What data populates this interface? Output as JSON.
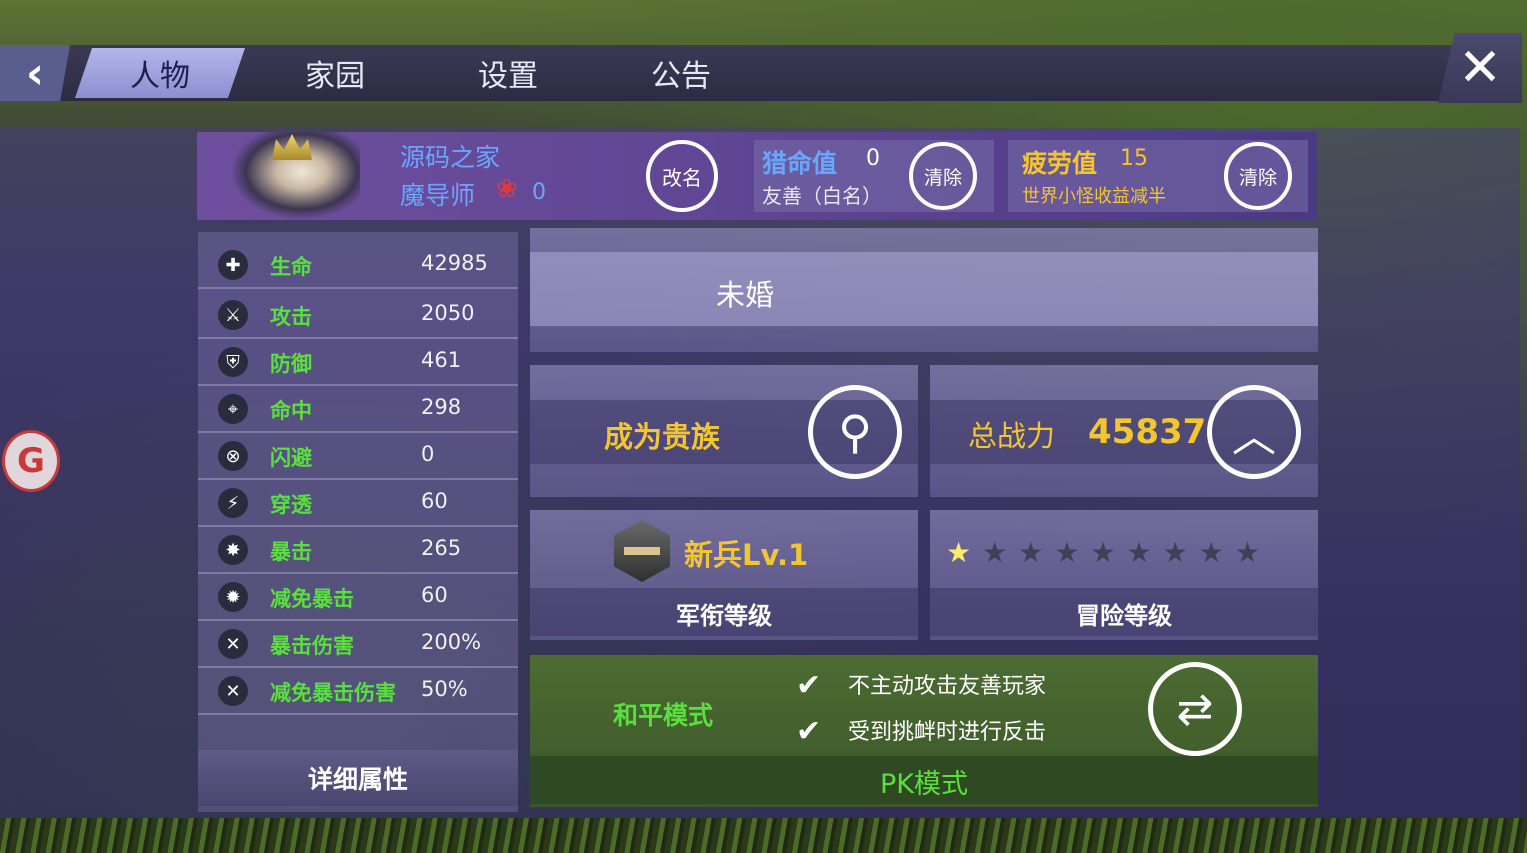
{
  "nav": {
    "tabs": [
      "人物",
      "家园",
      "设置",
      "公告"
    ],
    "active_tab": 0,
    "back_icon": "chevron-left-icon",
    "close_icon": "close-icon"
  },
  "profile": {
    "name": "源码之家",
    "class": "魔导师",
    "rose_count": "0",
    "rename_label": "改名"
  },
  "hunt": {
    "label": "猎命值",
    "value": "0",
    "status": "友善（白名）",
    "clear_label": "清除"
  },
  "fatigue": {
    "label": "疲劳值",
    "value": "15",
    "note": "世界小怪收益减半",
    "clear_label": "清除"
  },
  "stats": [
    {
      "icon": "plus-icon",
      "glyph": "✚",
      "name": "生命",
      "value": "42985"
    },
    {
      "icon": "sword-icon",
      "glyph": "⚔",
      "name": "攻击",
      "value": "2050"
    },
    {
      "icon": "shield-icon",
      "glyph": "⛨",
      "name": "防御",
      "value": "461"
    },
    {
      "icon": "crosshair-icon",
      "glyph": "⌖",
      "name": "命中",
      "value": "298"
    },
    {
      "icon": "dodge-icon",
      "glyph": "⊗",
      "name": "闪避",
      "value": "0"
    },
    {
      "icon": "pierce-icon",
      "glyph": "⚡",
      "name": "穿透",
      "value": "60"
    },
    {
      "icon": "crit-icon",
      "glyph": "✸",
      "name": "暴击",
      "value": "265"
    },
    {
      "icon": "crit-resist-icon",
      "glyph": "✹",
      "name": "减免暴击",
      "value": "60"
    },
    {
      "icon": "crit-damage-icon",
      "glyph": "✕",
      "name": "暴击伤害",
      "value": "200%"
    },
    {
      "icon": "crit-damage-resist-icon",
      "glyph": "✕",
      "name": "减免暴击伤害",
      "value": "50%"
    }
  ],
  "detail_label": "详细属性",
  "marriage_status": "未婚",
  "noble": {
    "label": "成为贵族"
  },
  "power": {
    "label": "总战力",
    "value": "45837"
  },
  "military": {
    "rank": "新兵Lv.1",
    "label": "军衔等级"
  },
  "adventure": {
    "stars_total": 9,
    "stars_filled": 1,
    "label": "冒险等级"
  },
  "pk": {
    "mode": "和平模式",
    "rules": [
      "不主动攻击友善玩家",
      "受到挑衅时进行反击"
    ],
    "label": "PK模式"
  },
  "colors": {
    "accent_green": "#58e03c",
    "accent_yellow": "#f2c531",
    "name_blue": "#69a7ff",
    "pk_bg": "#3f5a2a"
  }
}
